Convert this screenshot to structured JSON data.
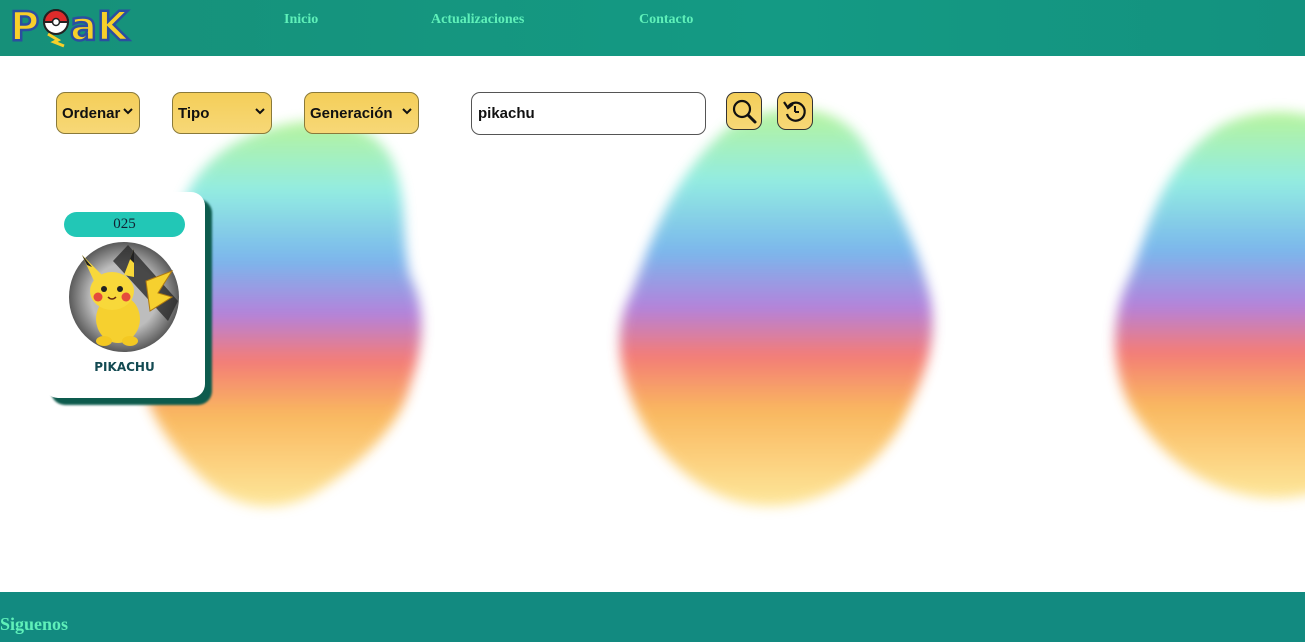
{
  "header": {
    "logo_text": "PoaK",
    "nav": [
      "Inicio",
      "Actualizaciones",
      "Contacto"
    ]
  },
  "filters": {
    "order_label": "Ordenar",
    "type_label": "Tipo",
    "generation_label": "Generación",
    "search_value": "pikachu"
  },
  "icons": {
    "search": "magnifier-icon",
    "reset": "refresh-icon",
    "dropdown": "chevron-down-icon"
  },
  "results": [
    {
      "number": "025",
      "name": "PIKACHU"
    }
  ],
  "footer": {
    "follow_label": "Siguenos"
  },
  "colors": {
    "header": "#149a84",
    "nav_text": "#5ff0b9",
    "button": "#f4ce59",
    "card_badge": "#22c7b6",
    "card_shadow": "#0d5b4d",
    "footer": "#128a80"
  }
}
